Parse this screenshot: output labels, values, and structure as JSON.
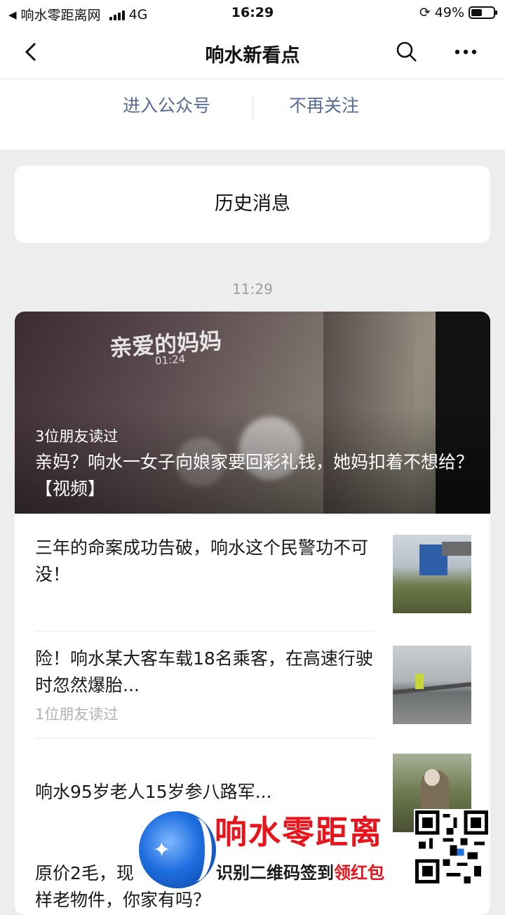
{
  "status_bar": {
    "back_app": "响水零距离网",
    "network": "4G",
    "time": "16:29",
    "battery": "49%",
    "battery_level": 0.49
  },
  "nav": {
    "title": "响水新看点"
  },
  "account_actions": {
    "enter": "进入公众号",
    "unfollow": "不再关注"
  },
  "history_label": "历史消息",
  "timestamp": "11:29",
  "feature": {
    "cover_call_text": "亲爱的妈妈",
    "cover_duration": "01:24",
    "readers": "3位朋友读过",
    "title": "亲妈？响水一女子向娘家要回彩礼钱，她妈扣着不想给？【视频】"
  },
  "articles": [
    {
      "title": "三年的命案成功告破，响水这个民警功不可没！",
      "readers": ""
    },
    {
      "title": "险！响水某大客车载18名乘客，在高速行驶时忽然爆胎...",
      "readers": "1位朋友读过"
    },
    {
      "title": "响水95岁老人15岁参八路军...",
      "readers": ""
    },
    {
      "title": "原价2毛，现",
      "subtitle": "样老物件，你家有吗？"
    }
  ],
  "watermark": {
    "name": "响水零距离",
    "slogan_black": "识别二维码签到",
    "slogan_red": "领红包"
  }
}
